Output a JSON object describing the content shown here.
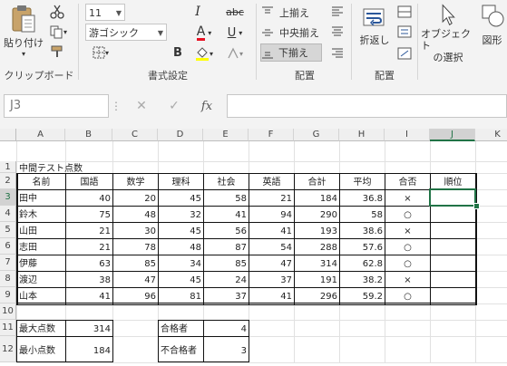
{
  "ribbon": {
    "clipboard": {
      "paste_label": "貼り付け",
      "group_label": "クリップボード"
    },
    "font": {
      "size": "11",
      "name": "游ゴシック",
      "bold": "B",
      "italic": "I",
      "strike": "abc",
      "font_color": "A",
      "underline": "U",
      "group_label": "書式設定"
    },
    "alignment": {
      "top": "上揃え",
      "middle": "中央揃え",
      "bottom": "下揃え",
      "group_label": "配置"
    },
    "wrap": {
      "label": "折返し",
      "group_label": "配置"
    },
    "objects": {
      "select_label": "オブジェクト\nの選択",
      "select_line1": "オブジェクト",
      "select_line2": "の選択",
      "shape_label": "図形"
    }
  },
  "formula_bar": {
    "name_box": "J3",
    "cancel": "✕",
    "enter": "✓",
    "fx": "fx",
    "content": ""
  },
  "columns": [
    "A",
    "B",
    "C",
    "D",
    "E",
    "F",
    "G",
    "H",
    "I",
    "J",
    "K"
  ],
  "rows": [
    "1",
    "2",
    "3",
    "4",
    "5",
    "6",
    "7",
    "8",
    "9",
    "10",
    "11",
    "12"
  ],
  "sheet": {
    "title": "中間テスト点数",
    "headers": [
      "名前",
      "国語",
      "数学",
      "理科",
      "社会",
      "英語",
      "合計",
      "平均",
      "合否",
      "順位"
    ],
    "data": [
      [
        "田中",
        "40",
        "20",
        "45",
        "58",
        "21",
        "184",
        "36.8",
        "×",
        ""
      ],
      [
        "鈴木",
        "75",
        "48",
        "32",
        "41",
        "94",
        "290",
        "58",
        "○",
        ""
      ],
      [
        "山田",
        "21",
        "30",
        "45",
        "56",
        "41",
        "193",
        "38.6",
        "×",
        ""
      ],
      [
        "志田",
        "21",
        "78",
        "48",
        "87",
        "54",
        "288",
        "57.6",
        "○",
        ""
      ],
      [
        "伊藤",
        "63",
        "85",
        "34",
        "85",
        "47",
        "314",
        "62.8",
        "○",
        ""
      ],
      [
        "渡辺",
        "38",
        "47",
        "45",
        "24",
        "37",
        "191",
        "38.2",
        "×",
        ""
      ],
      [
        "山本",
        "41",
        "96",
        "81",
        "37",
        "41",
        "296",
        "59.2",
        "○",
        ""
      ]
    ],
    "summary": {
      "max_label": "最大点数",
      "max_value": "314",
      "min_label": "最小点数",
      "min_value": "184",
      "pass_label": "合格者",
      "pass_value": "4",
      "fail_label": "不合格者",
      "fail_value": "3"
    }
  },
  "colors": {
    "accent": "#217346",
    "ribbon_bg": "#f3f3f3",
    "font_color_bar": "#e81123",
    "highlight_bar": "#ffff00"
  }
}
